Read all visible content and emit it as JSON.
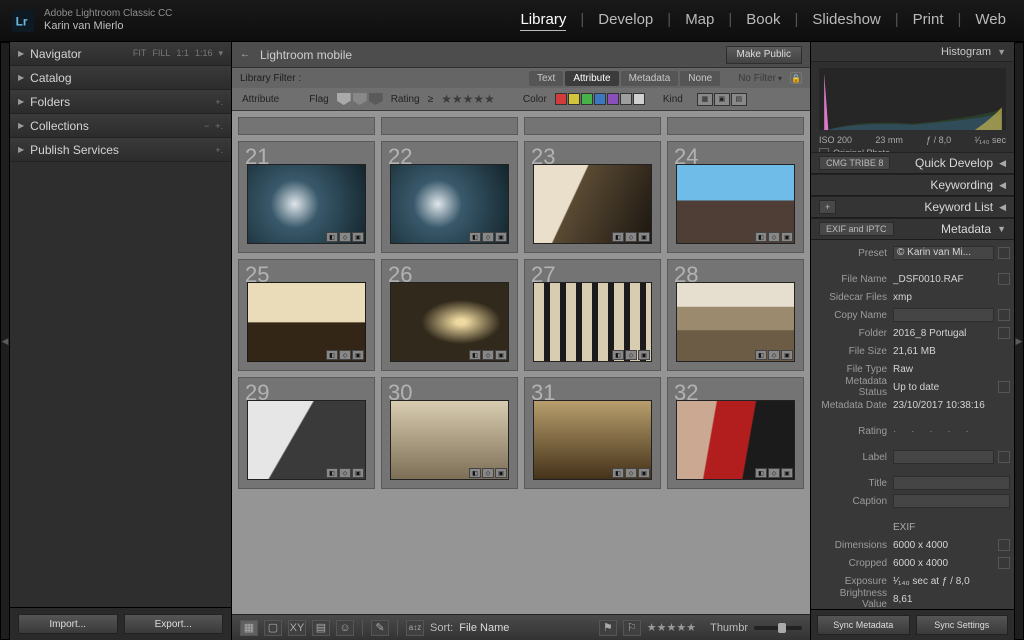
{
  "app": {
    "name": "Adobe Lightroom Classic CC",
    "user": "Karin van Mierlo"
  },
  "modules": [
    "Library",
    "Develop",
    "Map",
    "Book",
    "Slideshow",
    "Print",
    "Web"
  ],
  "modules_active": "Library",
  "left": {
    "navigator": {
      "label": "Navigator",
      "extras": [
        "FIT",
        "FILL",
        "1:1",
        "1:16",
        "▾"
      ]
    },
    "catalog": {
      "label": "Catalog"
    },
    "folders": {
      "label": "Folders",
      "extras": [
        "+."
      ]
    },
    "collections": {
      "label": "Collections",
      "extras": [
        "−",
        "+."
      ]
    },
    "publish": {
      "label": "Publish Services",
      "extras": [
        "+."
      ]
    },
    "import": "Import...",
    "export": "Export..."
  },
  "crumb": {
    "path": "Lightroom mobile",
    "make_public": "Make Public"
  },
  "filter": {
    "label": "Library Filter :",
    "tabs": [
      "Text",
      "Attribute",
      "Metadata",
      "None"
    ],
    "tab_active": "Attribute",
    "nofilter": "No Filter",
    "attribute": "Attribute",
    "flag": "Flag",
    "rating": "Rating",
    "color": "Color",
    "kind": "Kind",
    "swatches": [
      "#d23b3b",
      "#d3c43b",
      "#47b24a",
      "#3b78c0",
      "#8b4fbb",
      "#9e9e9e",
      "#d0d0d0"
    ]
  },
  "grid": {
    "start": 21,
    "cells": [
      21,
      22,
      23,
      24,
      25,
      26,
      27,
      28,
      29,
      30,
      31,
      32
    ]
  },
  "toolbar": {
    "sort_label": "Sort:",
    "sort_value": "File Name",
    "thumb": "Thumbr"
  },
  "right": {
    "histogram": {
      "title": "Histogram",
      "iso": "ISO 200",
      "focal": "23 mm",
      "fstop": "ƒ / 8,0",
      "shutter": "¹⁄₁₄₀ sec",
      "orig": "Original Photo"
    },
    "quick": {
      "chip": "CMG TRIBE 8",
      "title": "Quick Develop"
    },
    "keywording": {
      "title": "Keywording"
    },
    "keywordlist": {
      "plus": "+",
      "title": "Keyword List"
    },
    "metadata": {
      "chip": "EXIF and IPTC",
      "title": "Metadata"
    },
    "preset": {
      "label": "Preset",
      "value": "© Karin van Mi..."
    },
    "fields": [
      {
        "l": "File Name",
        "v": "_DSF0010.RAF",
        "act": 1
      },
      {
        "l": "Sidecar Files",
        "v": "xmp"
      },
      {
        "l": "Copy Name",
        "v": "",
        "f": 1,
        "act": 1
      },
      {
        "l": "Folder",
        "v": "2016_8 Portugal",
        "act": 1
      },
      {
        "l": "File Size",
        "v": "21,61 MB"
      },
      {
        "l": "File Type",
        "v": "Raw"
      },
      {
        "l": "Metadata Status",
        "v": "Up to date",
        "act": 1
      },
      {
        "l": "Metadata Date",
        "v": "23/10/2017 10:38:16"
      }
    ],
    "rating": {
      "l": "Rating",
      "v": "·  ·  ·  ·  ·"
    },
    "label": {
      "l": "Label",
      "v": ""
    },
    "title": {
      "l": "Title",
      "v": ""
    },
    "caption": {
      "l": "Caption",
      "v": ""
    },
    "exif_title": "EXIF",
    "exif": [
      {
        "l": "Dimensions",
        "v": "6000 x 4000",
        "act": 1
      },
      {
        "l": "Cropped",
        "v": "6000 x 4000",
        "act": 1
      },
      {
        "l": "Exposure",
        "v": "¹⁄₁₄₀ sec at ƒ / 8,0"
      },
      {
        "l": "Brightness Value",
        "v": "8,61"
      }
    ],
    "sync_meta": "Sync Metadata",
    "sync_set": "Sync Settings"
  }
}
